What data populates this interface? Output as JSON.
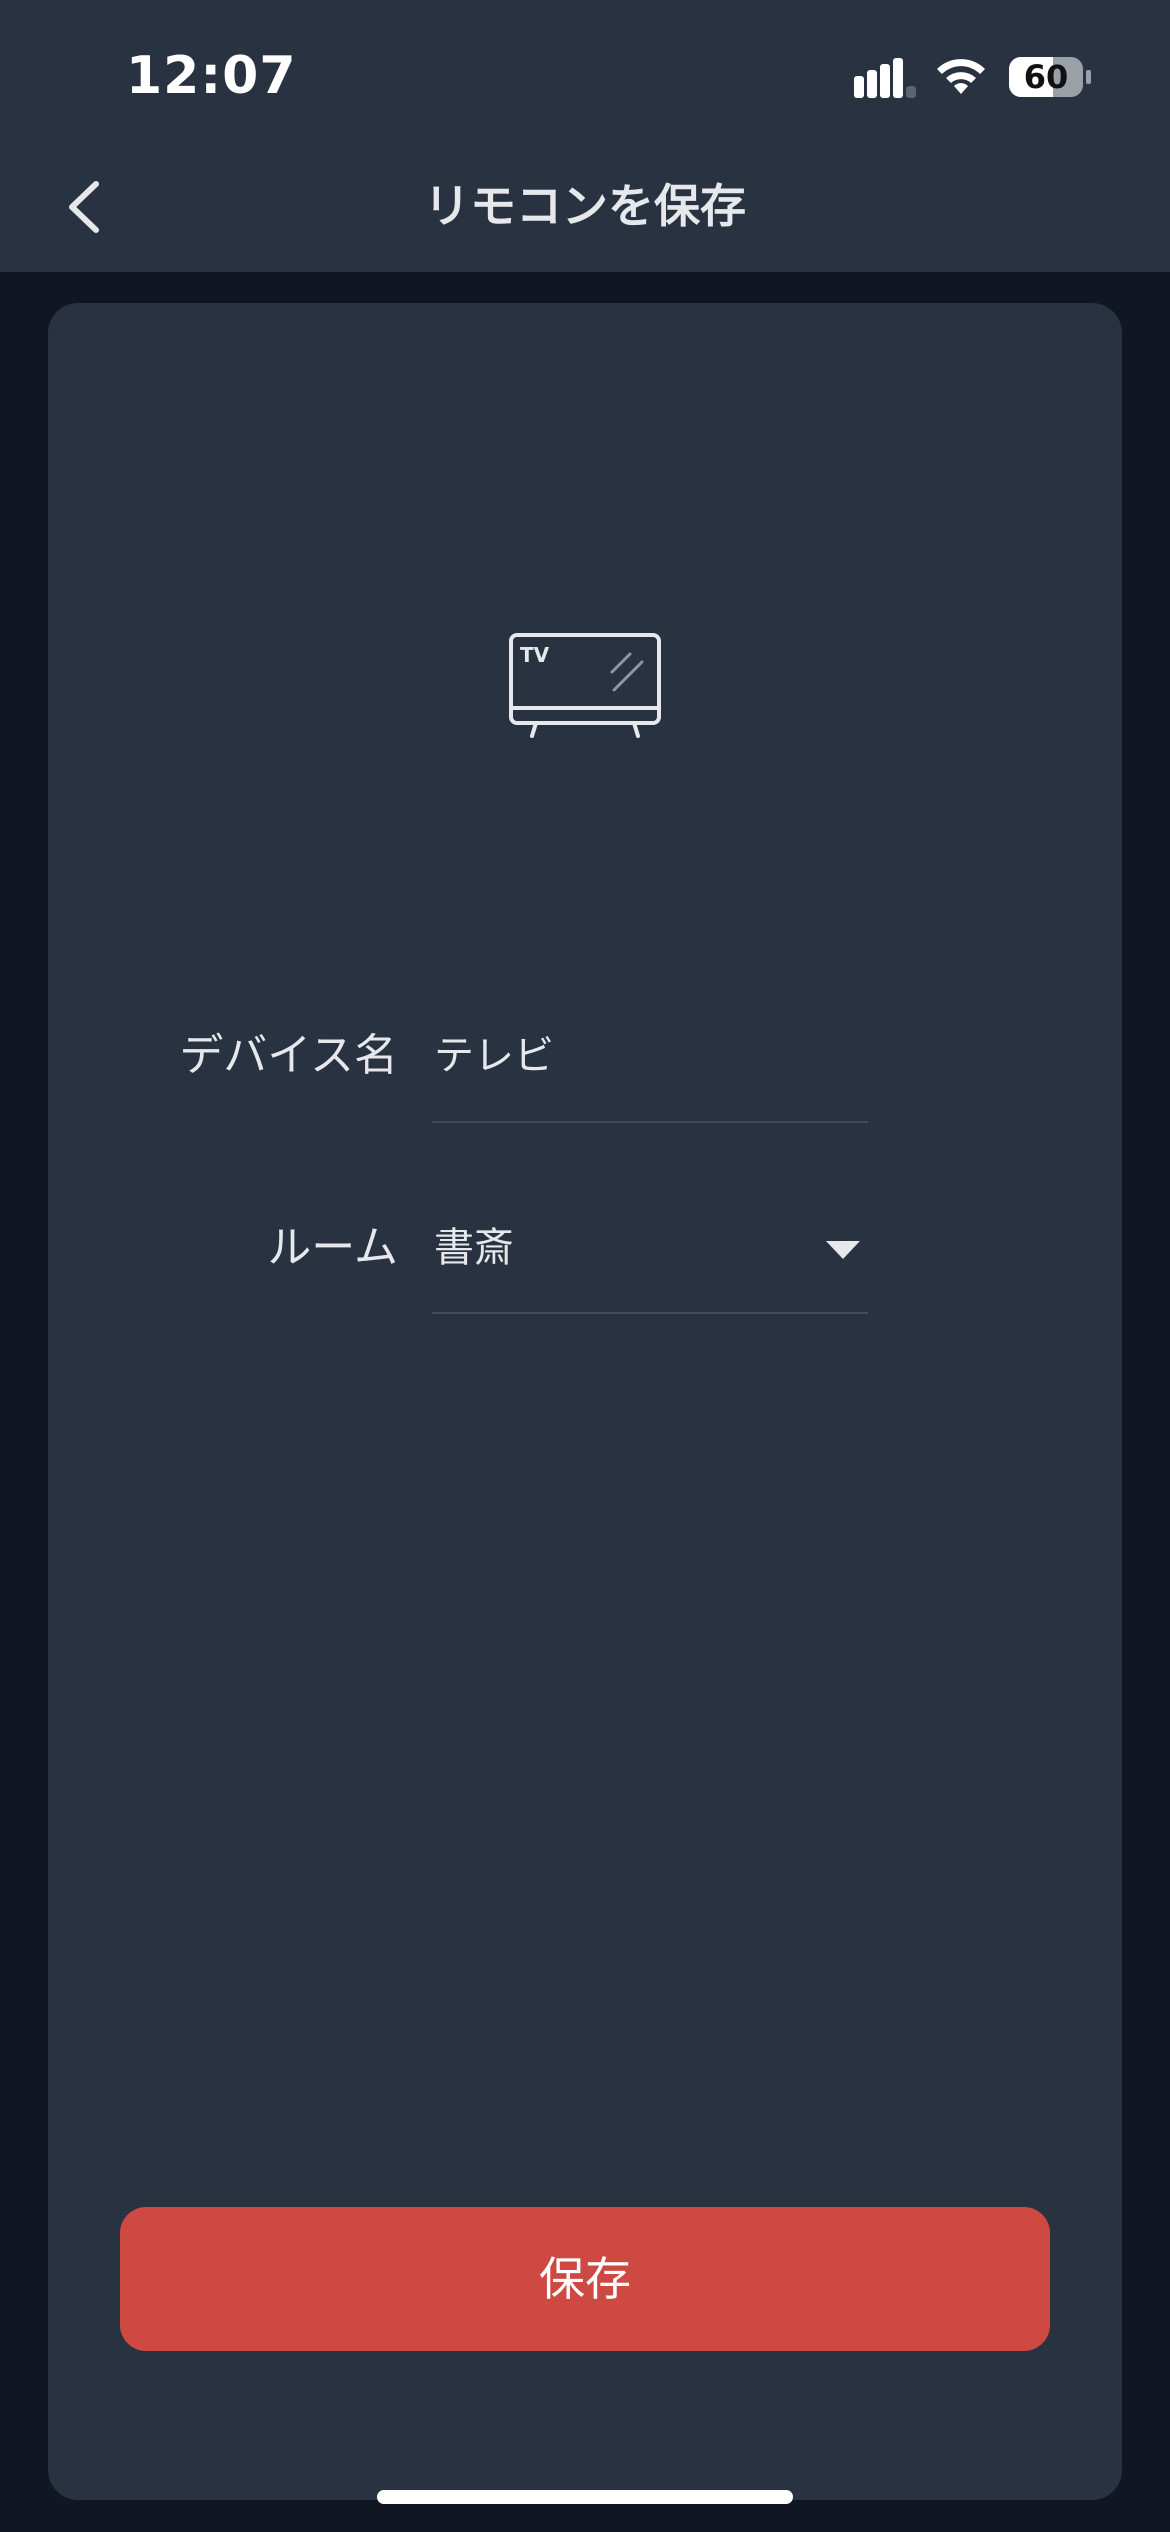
{
  "status_bar": {
    "time": "12:07",
    "battery_level": "60",
    "signal_icon": "cellular-signal-icon",
    "wifi_icon": "wifi-icon",
    "battery_icon": "battery-icon"
  },
  "header": {
    "title": "リモコンを保存",
    "back_icon": "chevron-left-icon"
  },
  "device": {
    "icon": "tv-icon",
    "icon_text": "TV"
  },
  "form": {
    "device_name_label": "デバイス名",
    "device_name_value": "テレビ",
    "room_label": "ルーム",
    "room_value": "書斎",
    "room_dropdown_icon": "caret-down-icon"
  },
  "actions": {
    "save_label": "保存"
  },
  "colors": {
    "header_bg": "#293241",
    "page_bg": "#111722",
    "card_bg": "#293241",
    "save_button": "#cf4943",
    "text": "#e6e8eb"
  }
}
